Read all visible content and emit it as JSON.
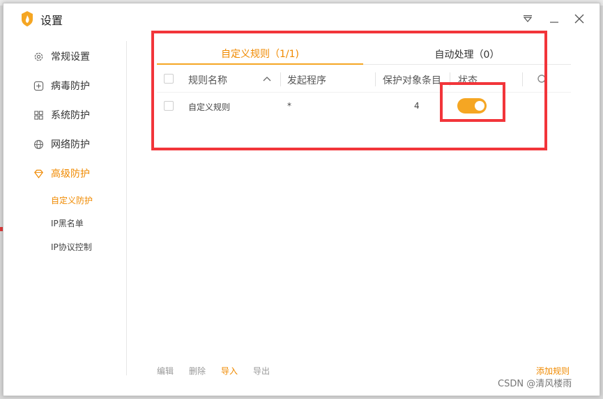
{
  "window": {
    "title": "设置"
  },
  "sidebar": {
    "items": [
      {
        "label": "常规设置",
        "icon": "gear-icon"
      },
      {
        "label": "病毒防护",
        "icon": "plus-box-icon"
      },
      {
        "label": "系统防护",
        "icon": "grid-icon"
      },
      {
        "label": "网络防护",
        "icon": "globe-icon"
      },
      {
        "label": "高级防护",
        "icon": "diamond-icon"
      }
    ],
    "subitems": [
      {
        "label": "自定义防护"
      },
      {
        "label": "IP黑名单"
      },
      {
        "label": "IP协议控制"
      }
    ]
  },
  "tabs": [
    {
      "label": "自定义规则（1/1)"
    },
    {
      "label": "自动处理（0）"
    }
  ],
  "table": {
    "headers": [
      "规则名称",
      "发起程序",
      "保护对象条目",
      "状态"
    ],
    "rows": [
      {
        "name": "自定义规则",
        "program": "*",
        "count": "4",
        "enabled": true
      }
    ]
  },
  "footer": {
    "edit": "编辑",
    "delete": "删除",
    "import": "导入",
    "export": "导出",
    "add_rule": "添加规则"
  },
  "watermark": "CSDN @清风楼雨",
  "colors": {
    "accent": "#f5a623",
    "accent_text": "#f08a00",
    "annotation": "#f2353a"
  }
}
